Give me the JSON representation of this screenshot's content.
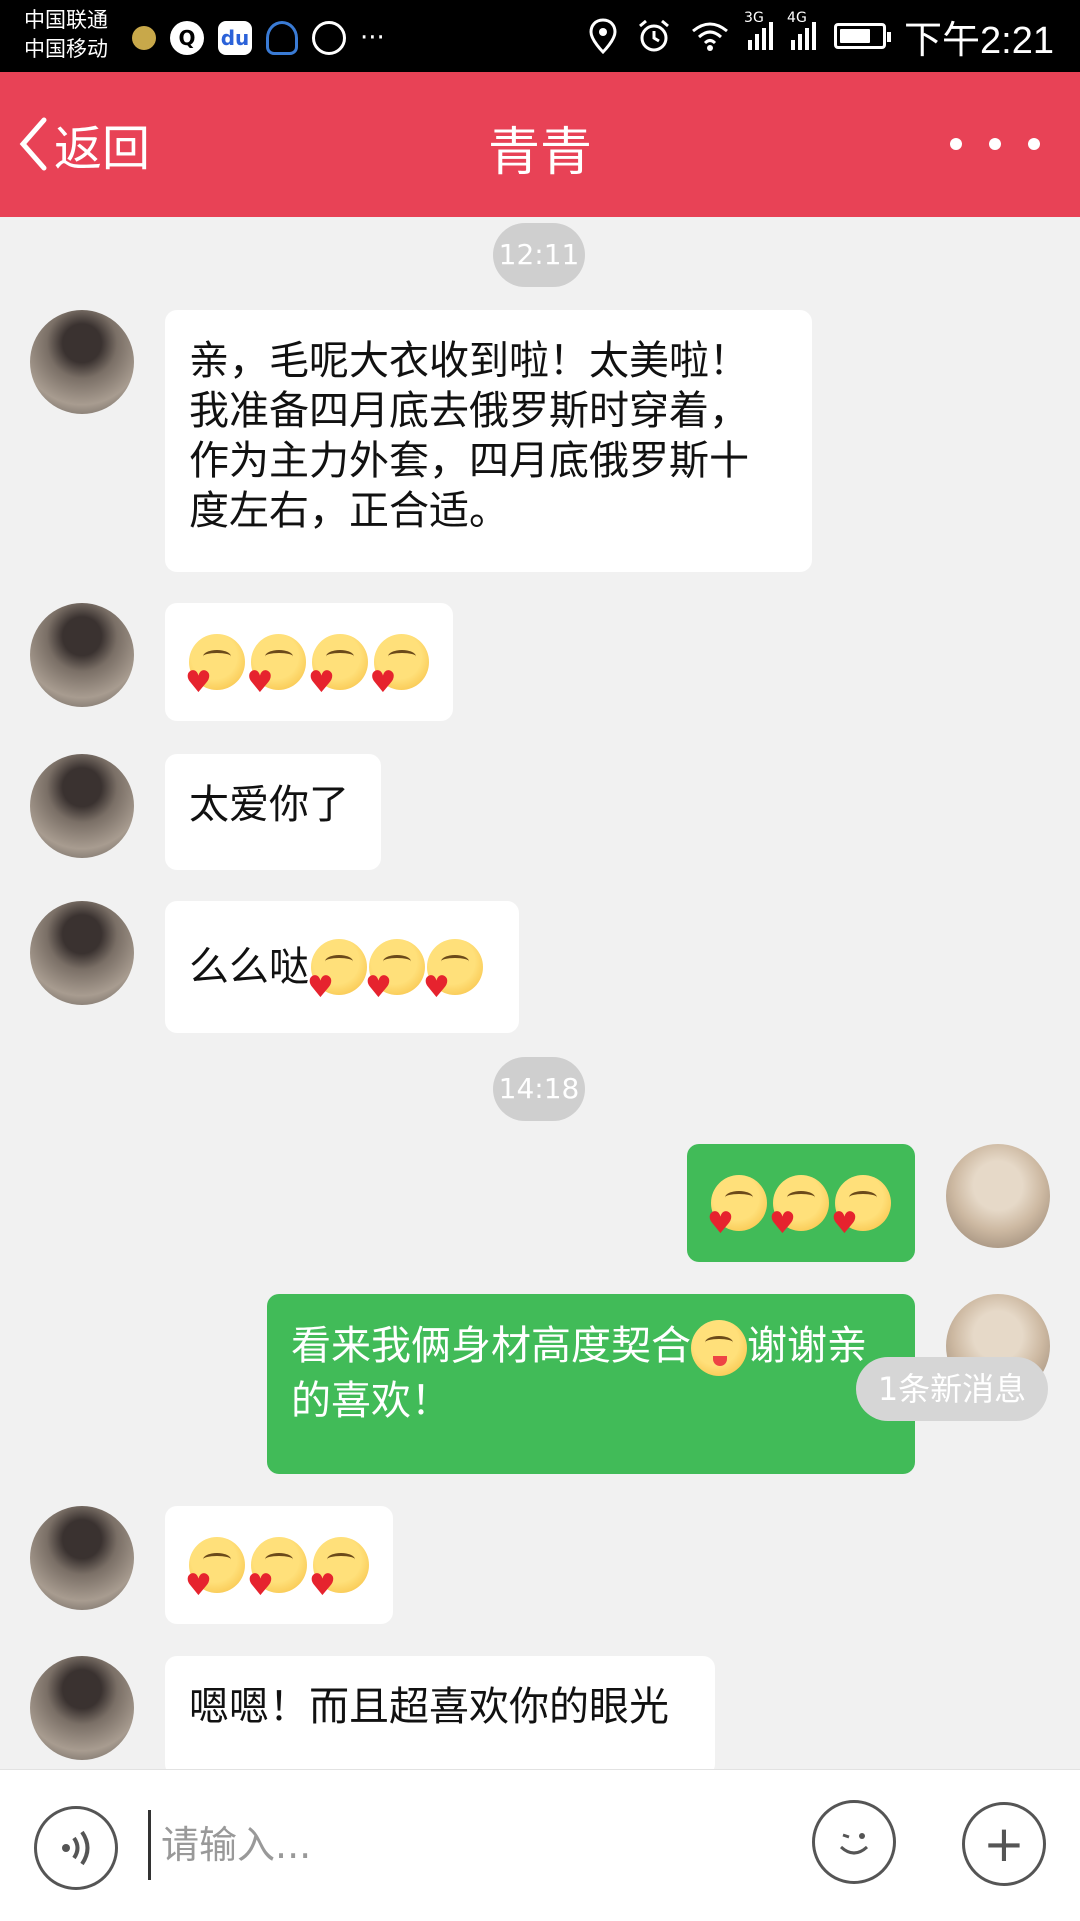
{
  "status_bar": {
    "carrier_1": "中国联通",
    "carrier_2": "中国移动",
    "more_icons": "···",
    "net_3g": "3G",
    "net_4g": "4G",
    "battery_level_percent": 75,
    "time": "下午2:21"
  },
  "header": {
    "back_label": "返回",
    "title": "青青"
  },
  "chat": {
    "timestamps": [
      "12:11",
      "14:18"
    ],
    "messages": [
      {
        "from": "friend",
        "text": "亲，毛呢大衣收到啦！太美啦！我准备四月底去俄罗斯时穿着，作为主力外套，四月底俄罗斯十度左右，正合适。"
      },
      {
        "from": "friend",
        "emoji_count": 4
      },
      {
        "from": "friend",
        "text": "太爱你了"
      },
      {
        "from": "friend",
        "text": "么么哒",
        "emoji_count": 3
      },
      {
        "from": "me",
        "emoji_count": 3
      },
      {
        "from": "me",
        "text_before": "看来我俩身材高度契合",
        "text_after": "谢谢亲的喜欢！"
      },
      {
        "from": "friend",
        "emoji_count": 3
      },
      {
        "from": "friend",
        "text": "嗯嗯！而且超喜欢你的眼光"
      }
    ],
    "new_message_badge": "1条新消息"
  },
  "input_bar": {
    "placeholder": "请输入...",
    "plus_label": "+"
  },
  "colors": {
    "header_bg": "#e84256",
    "outgoing_bubble": "#41bb58",
    "incoming_bubble": "#ffffff",
    "chat_bg": "#f1f1f1"
  }
}
